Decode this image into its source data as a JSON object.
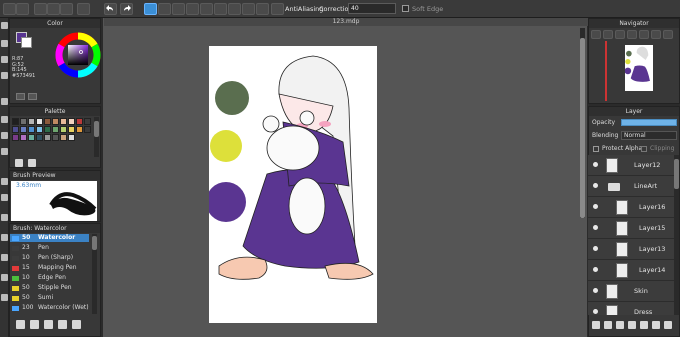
{
  "toolbar": {
    "antialiasing_label": "AntiAliasing",
    "correction_label": "Correction",
    "correction_value": "40",
    "soft_edge_label": "Soft Edge"
  },
  "color_panel": {
    "title": "Color",
    "readout": [
      "R:87",
      "G:52",
      "B:145",
      "#573491"
    ],
    "current_color": "#573491"
  },
  "palette_panel": {
    "title": "Palette",
    "colors": [
      "#1f1f1f",
      "#6f6f6f",
      "#b5b5b5",
      "#e8e8e8",
      "#8b5a3c",
      "#c08a63",
      "#e7b99a",
      "#f3d4c0",
      "#ba3a3a",
      "#3c3c3c",
      "#4e4e90",
      "#6a7fc4",
      "#4c8fd0",
      "#7ec0e8",
      "#2e6c4a",
      "#6da56e",
      "#b6d06f",
      "#e8d15e",
      "#e09a3c",
      "#3b3b3b",
      "#7a3c8a",
      "#b06fc2",
      "#6aaf9f",
      "#305060",
      "#9a9a9a",
      "#555",
      "#c9a27e",
      "#dcdcdc"
    ]
  },
  "brush_preview": {
    "title": "Brush Preview",
    "size": "3.63mm"
  },
  "brush_list": {
    "title": "Brush: Watercolor",
    "items": [
      {
        "size": "50",
        "name": "Watercolor",
        "color": "#4aa6ff",
        "selected": true
      },
      {
        "size": "23",
        "name": "Pen",
        "color": "#3c3c3c",
        "selected": false
      },
      {
        "size": "10",
        "name": "Pen (Sharp)",
        "color": "#3c3c3c",
        "selected": false
      },
      {
        "size": "15",
        "name": "Mapping Pen",
        "color": "#e23a3a",
        "selected": false
      },
      {
        "size": "10",
        "name": "Edge Pen",
        "color": "#4cbf3c",
        "selected": false
      },
      {
        "size": "50",
        "name": "Stipple Pen",
        "color": "#e8d22c",
        "selected": false
      },
      {
        "size": "50",
        "name": "Sumi",
        "color": "#e8d22c",
        "selected": false
      },
      {
        "size": "100",
        "name": "Watercolor (Wet)",
        "color": "#4aa6ff",
        "selected": false
      }
    ]
  },
  "document": {
    "tab_title": "123.mdp"
  },
  "navigator": {
    "title": "Navigator"
  },
  "layer_panel": {
    "title": "Layer",
    "opacity_label": "Opacity",
    "blending_label": "Blending",
    "blending_value": "Normal",
    "protect_alpha_label": "Protect Alpha",
    "clipping_label": "Clipping",
    "layers": [
      {
        "name": "Layer12",
        "indent": 0,
        "folder": false
      },
      {
        "name": "LineArt",
        "indent": 0,
        "folder": true
      },
      {
        "name": "Layer16",
        "indent": 1,
        "folder": false
      },
      {
        "name": "Layer15",
        "indent": 1,
        "folder": false
      },
      {
        "name": "Layer13",
        "indent": 1,
        "folder": false
      },
      {
        "name": "Layer14",
        "indent": 1,
        "folder": false
      },
      {
        "name": "Skin",
        "indent": 0,
        "folder": false
      },
      {
        "name": "Dress",
        "indent": 0,
        "folder": false
      }
    ]
  },
  "colors": {
    "accent": "#3b82c4",
    "circle_green": "#5a6e4f",
    "circle_yellow": "#dde03a",
    "circle_purple": "#5a3591"
  }
}
